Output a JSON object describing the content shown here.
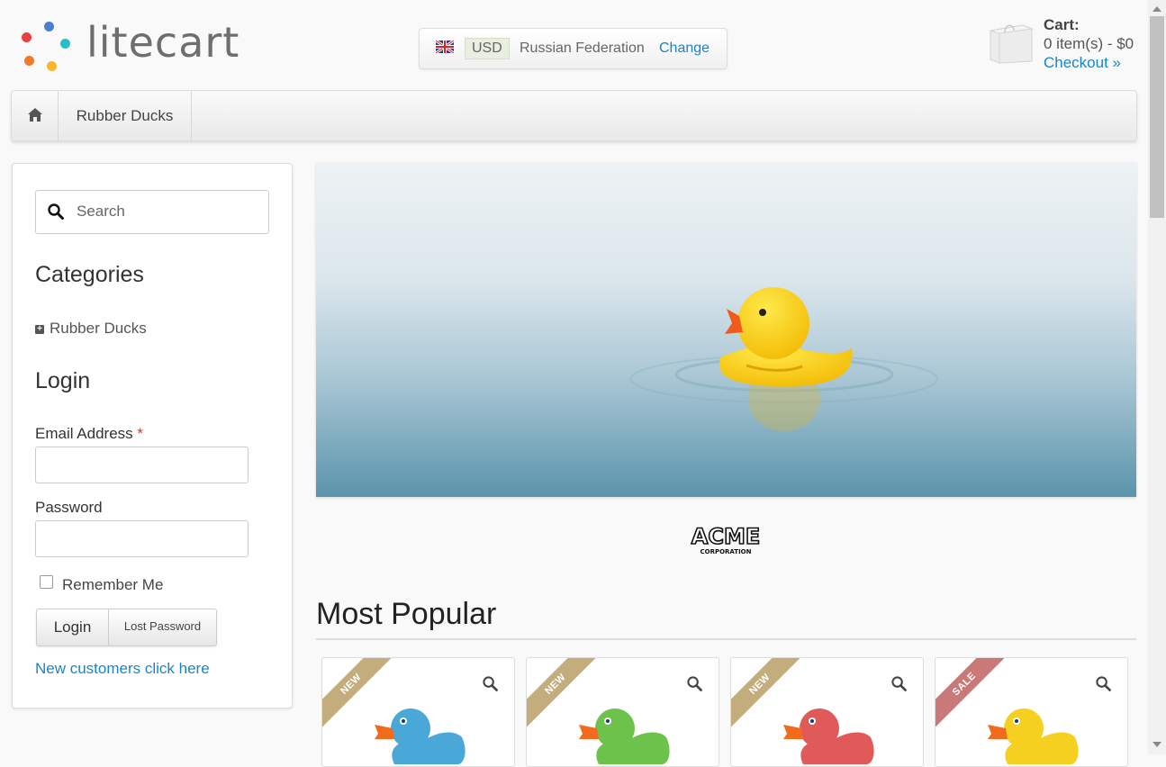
{
  "logo": {
    "text": "litecart"
  },
  "region": {
    "currency": "USD",
    "country": "Russian Federation",
    "change_label": "Change"
  },
  "cart": {
    "title": "Cart:",
    "items": "0 item(s) - $0",
    "checkout": "Checkout »"
  },
  "nav": {
    "items": [
      {
        "label": "Rubber Ducks"
      }
    ]
  },
  "sidebar": {
    "search_placeholder": "Search",
    "categories_title": "Categories",
    "categories": [
      {
        "label": "Rubber Ducks"
      }
    ],
    "login_title": "Login",
    "email_label": "Email Address",
    "required_mark": "*",
    "password_label": "Password",
    "remember_label": "Remember Me",
    "login_button": "Login",
    "lost_password_button": "Lost Password",
    "new_customers_link": "New customers click here"
  },
  "main": {
    "manufacturer_logo": "ACME CORPORATION",
    "most_popular_title": "Most Popular",
    "products": [
      {
        "badge": "NEW",
        "badge_color": "#c3ad7d",
        "duck_color": "#4aa8d8"
      },
      {
        "badge": "NEW",
        "badge_color": "#c3ad7d",
        "duck_color": "#6cc24a"
      },
      {
        "badge": "NEW",
        "badge_color": "#c3ad7d",
        "duck_color": "#e05a5a"
      },
      {
        "badge": "SALE",
        "badge_color": "#c97a78",
        "duck_color": "#f6d020"
      }
    ]
  },
  "colors": {
    "link": "#1a84c6",
    "brand_red": "#e8403c",
    "brand_blue": "#4c7fd0",
    "brand_teal": "#24c0c8",
    "brand_orange": "#f07a28",
    "brand_yellow": "#f5b82a"
  }
}
